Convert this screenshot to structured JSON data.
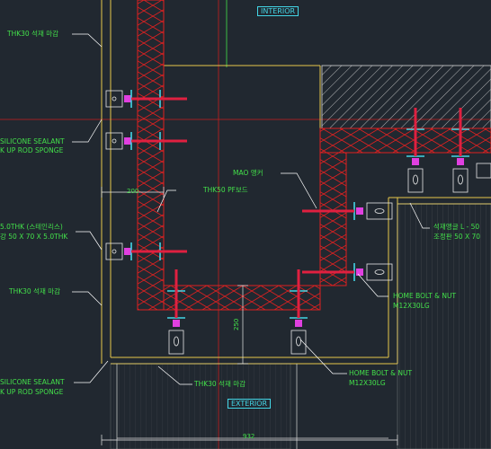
{
  "tags": {
    "interior": "INTERIOR",
    "exterior": "EXTERIOR"
  },
  "callouts": {
    "stone_finish_top": "THK30 석재 마감",
    "silicone_sealant_1": "SILICONE SEALANT",
    "backup_rod_1": "K UP ROD SPONGE",
    "thk_stainless_1": "5.0THK (스테인리스)",
    "thk_stainless_2": "강 50 X 70 X 5.0THK",
    "stone_finish_mid": "THK30 석재 마감",
    "silicone_sealant_2": "SILICONE SEALANT",
    "backup_rod_2": "K UP ROD SPONGE",
    "stone_finish_bottom": "THK30 석재 마감",
    "pf_board": "THK50 PF보드",
    "mao_anchor": "MAO 앵커",
    "stone_angle_1": "석재앵글 L - 50",
    "stone_angle_2": "조정판 50 X 70",
    "bolt_nut_1a": "HOME BOLT & NUT",
    "bolt_nut_1b": "M12X30LG",
    "bolt_nut_2a": "HOME BOLT & NUT",
    "bolt_nut_2b": "M12X30LG"
  },
  "dimensions": {
    "width_200": "200",
    "height_250": "250",
    "width_932": "932"
  },
  "colors": {
    "background": "#212830",
    "outline": "#e6c84a",
    "insulation": "#e02020",
    "hatch": "#d8d8d8",
    "steel": "#43d6e6",
    "anchor": "#e02040",
    "bracket": "#e040e0",
    "leader": "#ffffff",
    "label": "#43e04a"
  }
}
